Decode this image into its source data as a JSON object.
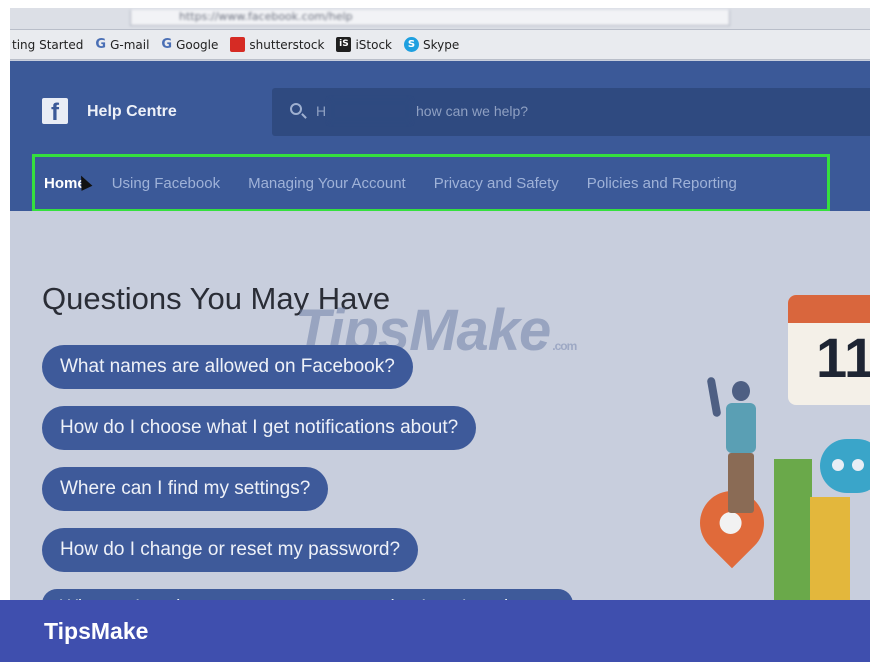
{
  "browser": {
    "url_text": "https://www.facebook.com/help",
    "bookmarks": [
      {
        "label": "ting Started",
        "icon": "none"
      },
      {
        "label": "G-mail",
        "icon": "google-g-icon"
      },
      {
        "label": "Google",
        "icon": "google-g-icon"
      },
      {
        "label": "shutterstock",
        "icon": "shutterstock-icon"
      },
      {
        "label": "iStock",
        "icon": "istock-icon"
      },
      {
        "label": "Skype",
        "icon": "skype-icon"
      }
    ]
  },
  "header": {
    "logo": "f",
    "title": "Help Centre",
    "search_prefix": "H",
    "search_placeholder": "how can we help?"
  },
  "nav": {
    "items": [
      "Home",
      "Using Facebook",
      "Managing Your Account",
      "Privacy and Safety",
      "Policies and Reporting"
    ]
  },
  "main": {
    "title": "Questions You May Have",
    "questions": [
      "What names are allowed on Facebook?",
      "How do I choose what I get notifications about?",
      "Where can I find my settings?",
      "How do I change or reset my password?",
      "Why am I seeing an error message saying I can't reply to a"
    ],
    "calendar_number": "11"
  },
  "watermark": {
    "text": "TipsMake",
    "suffix": ".com"
  },
  "banner": {
    "brand": "TipsMake"
  },
  "colors": {
    "facebook_blue": "#3b5998",
    "nav_highlight": "#35e03e",
    "banner": "#3f4fae"
  }
}
